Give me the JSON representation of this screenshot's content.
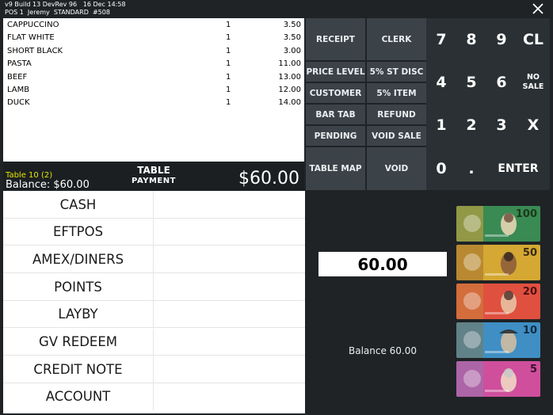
{
  "header": {
    "line1": "v9 Build 13 DevRev 96   16 Dec 14:58",
    "line2": "POS 1  Jeremy  STANDARD  #508"
  },
  "order": {
    "items": [
      {
        "name": "CAPPUCCINO",
        "qty": "1",
        "price": "3.50"
      },
      {
        "name": "FLAT WHITE",
        "qty": "1",
        "price": "3.50"
      },
      {
        "name": "SHORT BLACK",
        "qty": "1",
        "price": "3.00"
      },
      {
        "name": "PASTA",
        "qty": "1",
        "price": "11.00"
      },
      {
        "name": "BEEF",
        "qty": "1",
        "price": "13.00"
      },
      {
        "name": "LAMB",
        "qty": "1",
        "price": "12.00"
      },
      {
        "name": "DUCK",
        "qty": "1",
        "price": "14.00"
      }
    ]
  },
  "totals": {
    "table_name": "Table 10 (2)",
    "balance": "Balance: $60.00",
    "type_line1": "TABLE",
    "type_line2": "PAYMENT",
    "total": "$60.00"
  },
  "functions": {
    "receipt": "RECEIPT",
    "clerk": "CLERK",
    "price_level": "PRICE LEVEL",
    "st_disc": "5% ST DISC",
    "customer": "CUSTOMER",
    "item_disc": "5% ITEM",
    "bar_tab": "BAR TAB",
    "refund": "REFUND",
    "pending": "PENDING",
    "void_sale": "VOID SALE",
    "table_map": "TABLE MAP",
    "void": "VOID"
  },
  "keypad": {
    "k7": "7",
    "k8": "8",
    "k9": "9",
    "cl": "CL",
    "k4": "4",
    "k5": "5",
    "k6": "6",
    "no_sale_1": "NO",
    "no_sale_2": "SALE",
    "k1": "1",
    "k2": "2",
    "k3": "3",
    "x": "X",
    "k0": "0",
    "dot": ".",
    "enter": "ENTER"
  },
  "payment_methods": [
    "CASH",
    "EFTPOS",
    "AMEX/DINERS",
    "POINTS",
    "LAYBY",
    "GV REDEEM",
    "CREDIT NOTE",
    "ACCOUNT"
  ],
  "tender": {
    "amount": "60.00",
    "balance": "Balance 60.00"
  },
  "banknotes": [
    {
      "value": "100",
      "color": "#3a8a54",
      "accent": "#d9a43a"
    },
    {
      "value": "50",
      "color": "#d4a832",
      "accent": "#9c6a2e"
    },
    {
      "value": "20",
      "color": "#e0503f",
      "accent": "#c68a3a"
    },
    {
      "value": "10",
      "color": "#3f8fc4",
      "accent": "#8c7440"
    },
    {
      "value": "5",
      "color": "#cf4f9c",
      "accent": "#8a7bb0"
    }
  ],
  "colors": {
    "background": "#1f2326",
    "button": "#3c4348",
    "table_name": "#e6e600"
  }
}
